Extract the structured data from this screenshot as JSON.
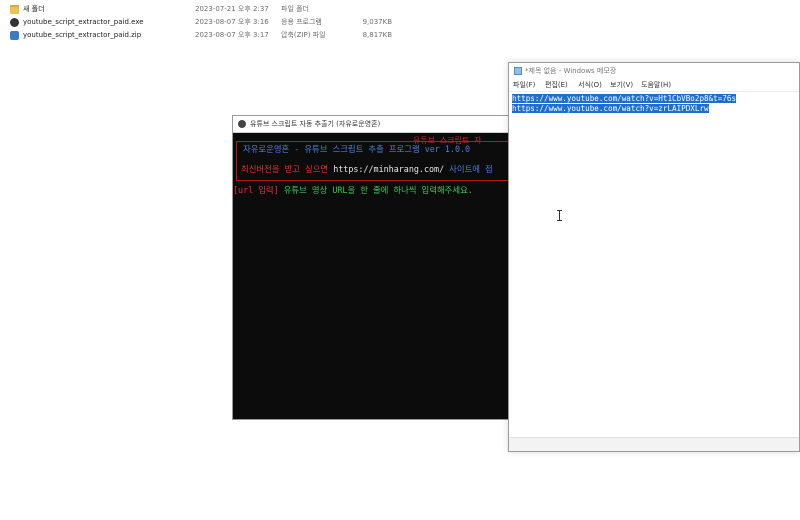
{
  "files": [
    {
      "icon": "folder-icon",
      "name": "새 폴더",
      "date": "2023-07-21 오후 2:37",
      "type": "파일 폴더",
      "size": ""
    },
    {
      "icon": "exe-icon",
      "name": "youtube_script_extractor_paid.exe",
      "date": "2023-08-07 오후 3:16",
      "type": "응용 프로그램",
      "size": "9,037KB"
    },
    {
      "icon": "zip-icon",
      "name": "youtube_script_extractor_paid.zip",
      "date": "2023-08-07 오후 3:17",
      "type": "압축(ZIP) 파일",
      "size": "8,817KB"
    }
  ],
  "console": {
    "title": "유튜브 스크립트 자동 추출기 (자유로운영혼)",
    "banner_top": "유튜브 스크립트 자",
    "banner_line1": "자유로운영혼 - 유튜브 스크립트 추출 프로그램 ver 1.0.0",
    "banner_line2_a": "최신버전을 받고 싶으면 ",
    "banner_line2_url": "https://minharang.com/",
    "banner_line2_b": " 사이트에 접",
    "prompt_tag": "[url 입력]",
    "prompt_text": " 유튜브 영상 URL을 한 줄에 하나씩 입력해주세요."
  },
  "notepad": {
    "title": "*제목 없음 - Windows 메모장",
    "menu": [
      "파일(F)",
      "편집(E)",
      "서식(O)",
      "보기(V)",
      "도움말(H)"
    ],
    "lines": [
      "https://www.youtube.com/watch?v=Ht1CbVBo2p8&t=76s",
      "https://www.youtube.com/watch?v=zrLAIPDXLrw"
    ]
  },
  "colors": {
    "console_bg": "#0c0c0c",
    "console_red": "#e63030",
    "console_green": "#3fc552",
    "console_blue": "#4f7ee0",
    "selection": "#1e6ed0",
    "folder": "#e9c25a"
  }
}
